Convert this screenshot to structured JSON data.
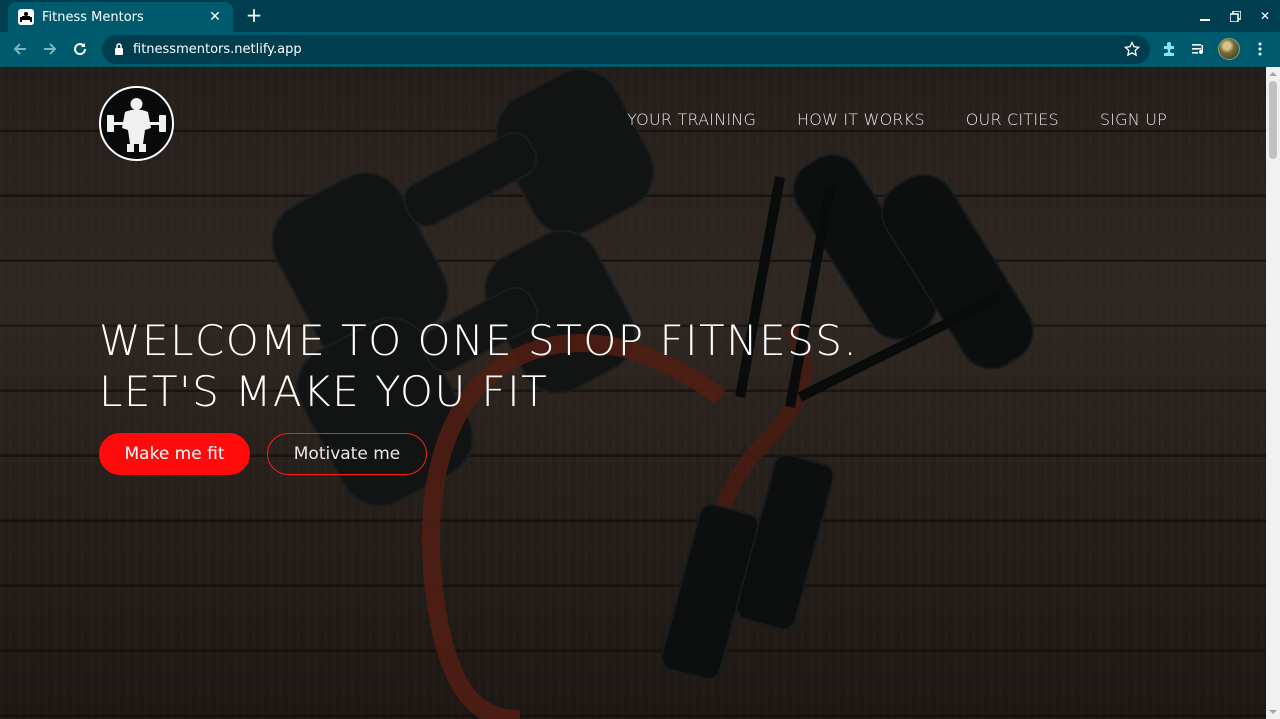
{
  "browser": {
    "tab_title": "Fitness Mentors",
    "url": "fitnessmentors.netlify.app"
  },
  "site": {
    "nav": [
      "YOUR TRAINING",
      "HOW IT WORKS",
      "OUR CITIES",
      "SIGN UP"
    ],
    "hero": {
      "line1": "WELCOME TO ONE STOP FITNESS.",
      "line2": "LET'S MAKE YOU FIT"
    },
    "buttons": {
      "primary": "Make me fit",
      "secondary": "Motivate me"
    }
  },
  "colors": {
    "chrome_dark": "#003d4e",
    "chrome_tab": "#005a6e",
    "accent_red": "#ff0b0b"
  },
  "icons": [
    "back-arrow-icon",
    "forward-arrow-icon",
    "reload-icon",
    "lock-icon",
    "star-icon",
    "extensions-icon",
    "media-queue-icon",
    "menu-dots-icon"
  ]
}
